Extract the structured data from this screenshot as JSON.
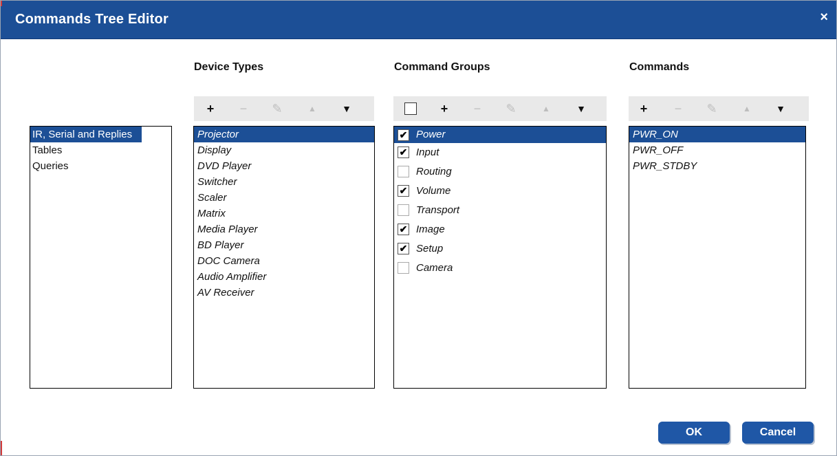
{
  "window": {
    "title": "Commands Tree Editor",
    "close_glyph": "×"
  },
  "categories": {
    "items": [
      {
        "label": "IR, Serial and Replies",
        "selected": true
      },
      {
        "label": "Tables",
        "selected": false
      },
      {
        "label": "Queries",
        "selected": false
      }
    ]
  },
  "device_types": {
    "header": "Device Types",
    "items": [
      {
        "label": "Projector",
        "selected": true
      },
      {
        "label": "Display"
      },
      {
        "label": "DVD Player"
      },
      {
        "label": "Switcher"
      },
      {
        "label": "Scaler"
      },
      {
        "label": "Matrix"
      },
      {
        "label": "Media Player"
      },
      {
        "label": "BD Player"
      },
      {
        "label": "DOC Camera"
      },
      {
        "label": "Audio Amplifier"
      },
      {
        "label": "AV Receiver"
      }
    ]
  },
  "command_groups": {
    "header": "Command Groups",
    "items": [
      {
        "label": "Power",
        "checked": true,
        "selected": true
      },
      {
        "label": "Input",
        "checked": true
      },
      {
        "label": "Routing",
        "checked": false
      },
      {
        "label": "Volume",
        "checked": true
      },
      {
        "label": "Transport",
        "checked": false
      },
      {
        "label": "Image",
        "checked": true
      },
      {
        "label": "Setup",
        "checked": true
      },
      {
        "label": "Camera",
        "checked": false
      }
    ]
  },
  "commands": {
    "header": "Commands",
    "items": [
      {
        "label": "PWR_ON",
        "selected": true
      },
      {
        "label": "PWR_OFF"
      },
      {
        "label": "PWR_STDBY"
      }
    ]
  },
  "toolbar": {
    "add": "+",
    "remove": "−",
    "edit": "✎",
    "up": "▲",
    "down": "▼",
    "check": "✔"
  },
  "buttons": {
    "ok": "OK",
    "cancel": "Cancel"
  },
  "colors": {
    "titlebar": "#1c4f96",
    "selection": "#1c4f96",
    "button": "#1f57a6"
  }
}
